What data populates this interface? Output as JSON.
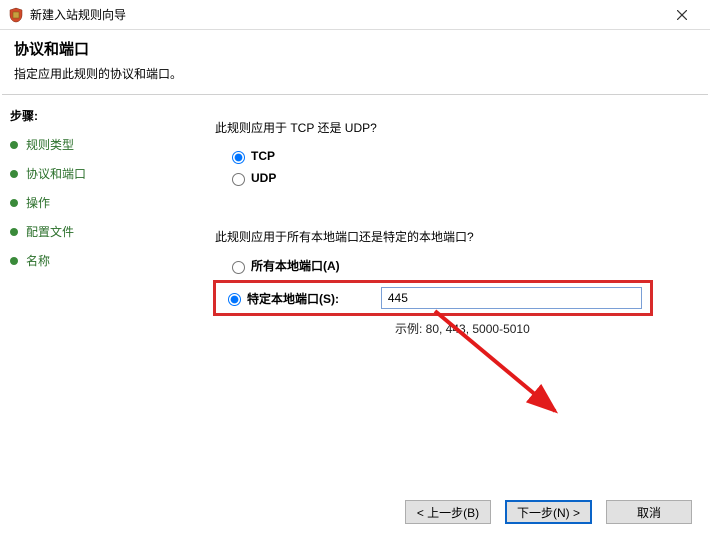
{
  "window": {
    "title": "新建入站规则向导"
  },
  "header": {
    "title": "协议和端口",
    "subtitle": "指定应用此规则的协议和端口。"
  },
  "sidebar": {
    "steps_label": "步骤:",
    "items": [
      {
        "label": "规则类型"
      },
      {
        "label": "协议和端口"
      },
      {
        "label": "操作"
      },
      {
        "label": "配置文件"
      },
      {
        "label": "名称"
      }
    ]
  },
  "main": {
    "q1": "此规则应用于 TCP 还是 UDP?",
    "opt_tcp": "TCP",
    "opt_udp": "UDP",
    "q2": "此规则应用于所有本地端口还是特定的本地端口?",
    "opt_all_ports": "所有本地端口(A)",
    "opt_specific_ports": "特定本地端口(S):",
    "port_value": "445",
    "example_label": "示例: 80, 443, 5000-5010"
  },
  "footer": {
    "back": "< 上一步(B)",
    "next": "下一步(N) >",
    "cancel": "取消"
  }
}
